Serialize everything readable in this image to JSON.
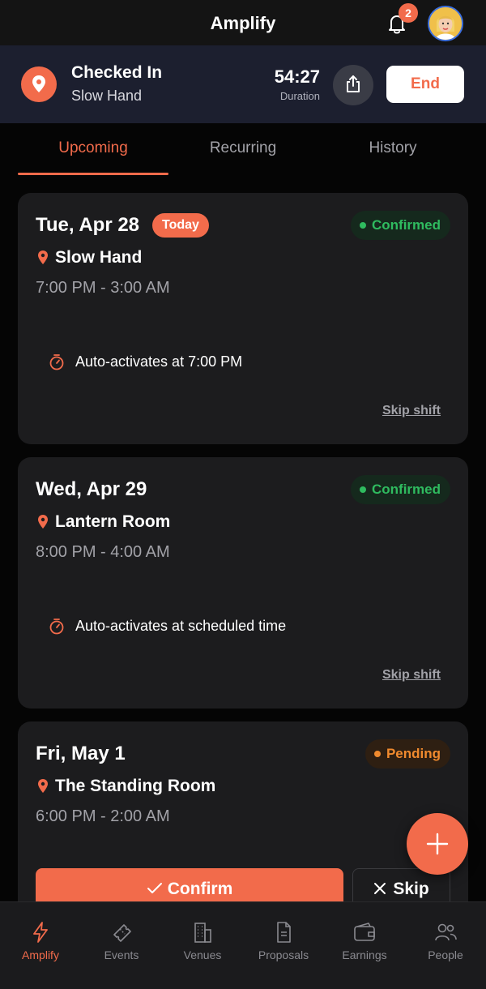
{
  "header": {
    "title": "Amplify",
    "notification_count": "2",
    "bell_icon": "bell-icon",
    "avatar_icon": "user-avatar"
  },
  "banner": {
    "status": "Checked In",
    "venue": "Slow Hand",
    "timer": "54:27",
    "timer_label": "Duration",
    "end_label": "End",
    "share_icon": "share-icon"
  },
  "tabs": [
    {
      "label": "Upcoming",
      "active": true
    },
    {
      "label": "Recurring",
      "active": false
    },
    {
      "label": "History",
      "active": false
    }
  ],
  "shifts": [
    {
      "date": "Tue, Apr 28",
      "badge": "Today",
      "status": "Confirmed",
      "venue": "Slow Hand",
      "time": "7:00 PM - 3:00 AM",
      "auto_text": "Auto-activates at 7:00 PM",
      "skip_label": "Skip shift"
    },
    {
      "date": "Wed, Apr 29",
      "status": "Confirmed",
      "venue": "Lantern Room",
      "time": "8:00 PM - 4:00 AM",
      "auto_text": "Auto-activates at scheduled time",
      "skip_label": "Skip shift"
    },
    {
      "date": "Fri, May 1",
      "status": "Pending",
      "venue": "The Standing Room",
      "time": "6:00 PM - 2:00 AM",
      "confirm_label": "Confirm",
      "skip_label": "Skip"
    }
  ],
  "nav": [
    {
      "label": "Amplify",
      "icon": "bolt-icon",
      "active": true
    },
    {
      "label": "Events",
      "icon": "ticket-icon",
      "active": false
    },
    {
      "label": "Venues",
      "icon": "building-icon",
      "active": false
    },
    {
      "label": "Proposals",
      "icon": "document-icon",
      "active": false
    },
    {
      "label": "Earnings",
      "icon": "wallet-icon",
      "active": false
    },
    {
      "label": "People",
      "icon": "people-icon",
      "active": false
    }
  ],
  "colors": {
    "accent": "#f26b4b",
    "confirmed": "#2fbb5f",
    "pending": "#f08a2e",
    "banner_bg": "#1c1f2f",
    "card_bg": "#1c1c1e"
  }
}
